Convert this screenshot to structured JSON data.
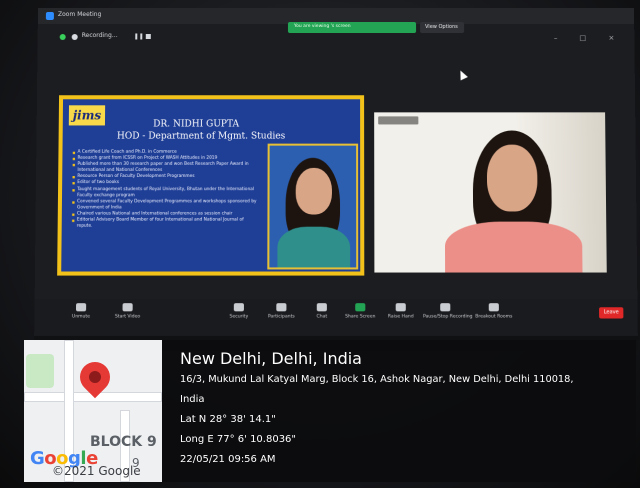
{
  "zoom": {
    "window_title": "Zoom Meeting",
    "recording_label": "Recording...",
    "share_banner": "You are viewing 's screen",
    "view_options": "View Options",
    "toolbar": [
      {
        "label": "Unmute",
        "icon": "microphone-icon"
      },
      {
        "label": "Start Video",
        "icon": "video-camera-icon"
      },
      {
        "label": "Security",
        "icon": "shield-icon"
      },
      {
        "label": "Participants",
        "icon": "participants-icon"
      },
      {
        "label": "Chat",
        "icon": "chat-icon"
      },
      {
        "label": "Share Screen",
        "icon": "share-screen-icon"
      },
      {
        "label": "Raise Hand",
        "icon": "hand-icon"
      },
      {
        "label": "Pause/Stop Recording",
        "icon": "record-icon"
      },
      {
        "label": "Breakout Rooms",
        "icon": "breakout-rooms-icon"
      }
    ],
    "end_label": "Leave"
  },
  "slide": {
    "logo": "jims",
    "name": "DR. NIDHI GUPTA",
    "role": "HOD - Department of Mgmt. Studies",
    "bullets": [
      "A Certified Life Coach and Ph.D. in Commerce",
      "Research grant from ICSSR on Project of WASH Attitudes in 2019",
      "Published more than 30 research paper and won Best Research Paper Award in International and National Conferences",
      "Resource Person of Faculty Development Programmes",
      "Editor of two books",
      "Taught management students of Royal University, Bhutan under the International Faculty exchange program",
      "Convened several Faculty Development Programmes and workshops sponsored by Government of India",
      "Chaired various National and International conferences as session chair",
      "Editorial Advisory Board Member of four International and National Journal of repute."
    ]
  },
  "geotag": {
    "city": "New Delhi, Delhi, India",
    "address_line_1": "16/3, Mukund Lal Katyal Marg, Block 16, Ashok Nagar, New Delhi, Delhi 110018,",
    "address_line_2": "India",
    "latitude": "Lat N 28° 38' 14.1\"",
    "longitude": "Long E 77° 6' 10.8036\"",
    "timestamp": "22/05/21 09:56 AM",
    "map": {
      "block_label": "BLOCK 9",
      "nine_label": "9",
      "google_logo": "Google",
      "copyright": "©2021 Google",
      "pin_color": "#e53935"
    }
  },
  "colors": {
    "slide_background": "#1f3e96",
    "slide_border": "#f2c21a",
    "share_banner": "#23a455",
    "end_button": "#e02828"
  }
}
